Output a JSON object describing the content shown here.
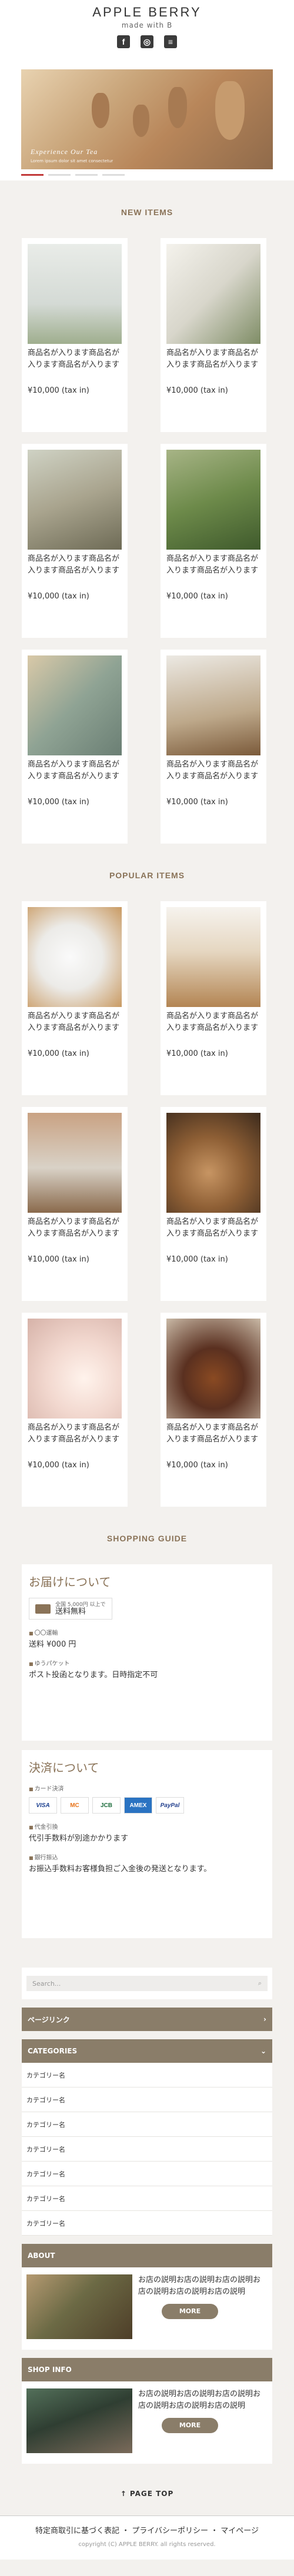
{
  "header": {
    "logo": "APPLE BERRY",
    "tagline": "made with B",
    "social": [
      "f",
      "◎",
      "≡"
    ]
  },
  "hero": {
    "caption": "Experience Our Tea",
    "sub": "Lorem ipsum dolor sit amet consectetur"
  },
  "new_items": {
    "title": "NEW ITEMS",
    "products": [
      {
        "name": "商品名が入ります商品名が入ります商品名が入ります",
        "price": "¥10,000 (tax in)"
      },
      {
        "name": "商品名が入ります商品名が入ります商品名が入ります",
        "price": "¥10,000 (tax in)"
      },
      {
        "name": "商品名が入ります商品名が入ります商品名が入ります",
        "price": "¥10,000 (tax in)"
      },
      {
        "name": "商品名が入ります商品名が入ります商品名が入ります",
        "price": "¥10,000 (tax in)"
      },
      {
        "name": "商品名が入ります商品名が入ります商品名が入ります",
        "price": "¥10,000 (tax in)"
      },
      {
        "name": "商品名が入ります商品名が入ります商品名が入ります",
        "price": "¥10,000 (tax in)"
      }
    ]
  },
  "popular_items": {
    "title": "POPULAR ITEMS",
    "products": [
      {
        "name": "商品名が入ります商品名が入ります商品名が入ります",
        "price": "¥10,000 (tax in)"
      },
      {
        "name": "商品名が入ります商品名が入ります商品名が入ります",
        "price": "¥10,000 (tax in)"
      },
      {
        "name": "商品名が入ります商品名が入ります商品名が入ります",
        "price": "¥10,000 (tax in)"
      },
      {
        "name": "商品名が入ります商品名が入ります商品名が入ります",
        "price": "¥10,000 (tax in)"
      },
      {
        "name": "商品名が入ります商品名が入ります商品名が入ります",
        "price": "¥10,000 (tax in)"
      },
      {
        "name": "商品名が入ります商品名が入ります商品名が入ります",
        "price": "¥10,000 (tax in)"
      }
    ]
  },
  "guide": {
    "title": "SHOPPING GUIDE",
    "delivery_title": "お届けについて",
    "free_small": "全国 5,000円 以上で",
    "free_big": "送料無料",
    "ship1_head": "〇〇運輸",
    "ship1_text": "送料 ¥000 円",
    "ship2_head": "ゆうパケット",
    "ship2_text": "ポスト投函となります。日時指定不可",
    "payment_title": "決済について",
    "pay1_head": "カード決済",
    "cards": [
      "VISA",
      "MC",
      "JCB",
      "AMEX",
      "PayPal"
    ],
    "pay2_head": "代金引換",
    "pay2_text": "代引手数料が別途かかります",
    "pay3_head": "銀行振込",
    "pay3_text": "お振込手数料お客様負担ご入金後の発送となります。"
  },
  "sidebar": {
    "search_placeholder": "Search...",
    "pagelink": "ページリンク",
    "categories": "CATEGORIES",
    "cat_items": [
      "カテゴリー名",
      "カテゴリー名",
      "カテゴリー名",
      "カテゴリー名",
      "カテゴリー名",
      "カテゴリー名",
      "カテゴリー名"
    ],
    "about_title": "ABOUT",
    "about_text": "お店の説明お店の説明お店の説明お店の説明お店の説明お店の説明",
    "more": "MORE",
    "shop_title": "SHOP INFO",
    "shop_text": "お店の説明お店の説明お店の説明お店の説明お店の説明お店の説明"
  },
  "footer": {
    "pagetop": "↑ PAGE TOP",
    "links": "特定商取引に基づく表記 ・ プライバシーポリシー ・ マイページ",
    "copyright": "copyright (C) APPLE BERRY. all rights reserved."
  }
}
